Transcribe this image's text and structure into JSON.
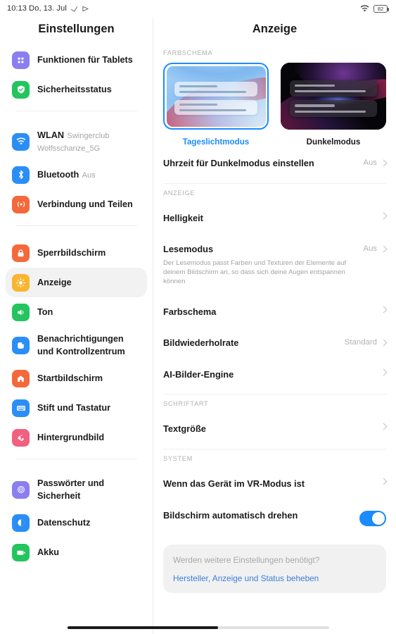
{
  "statusbar": {
    "time_date": "10:13 Do, 13. Jul",
    "left_icons": [
      "silent-mode-icon",
      "location-icon"
    ],
    "wifi_icon": "wifi-icon",
    "battery_level": "82"
  },
  "sidebar": {
    "title": "Einstellungen",
    "groups": [
      {
        "items": [
          {
            "label": "Funktionen für Tablets",
            "sub": "",
            "icon": "tablet-features-icon",
            "color": "#8b7ef0"
          },
          {
            "label": "Sicherheitsstatus",
            "sub": "",
            "icon": "security-shield-icon",
            "color": "#23c55e"
          }
        ]
      },
      {
        "items": [
          {
            "label": "WLAN",
            "sub": "Swingerclub Wolfsschanze_5G",
            "icon": "wifi-icon",
            "color": "#2b8ef5"
          },
          {
            "label": "Bluetooth",
            "sub": "Aus",
            "icon": "bluetooth-icon",
            "color": "#2b8ef5"
          },
          {
            "label": "Verbindung und Teilen",
            "sub": "",
            "icon": "share-connect-icon",
            "color": "#f4693b"
          }
        ]
      },
      {
        "items": [
          {
            "label": "Sperrbildschirm",
            "sub": "",
            "icon": "lock-icon",
            "color": "#f4693b"
          },
          {
            "label": "Anzeige",
            "sub": "",
            "icon": "brightness-sun-icon",
            "color": "#f9b battery",
            "selected": true
          },
          {
            "label": "Ton",
            "sub": "",
            "icon": "speaker-icon",
            "color": "#23c55e"
          },
          {
            "label": "Benachrichtigungen und Kontrollzentrum",
            "sub": "",
            "icon": "notifications-icon",
            "color": "#2b8ef5"
          },
          {
            "label": "Startbildschirm",
            "sub": "",
            "icon": "home-icon",
            "color": "#f4693b"
          },
          {
            "label": "Stift und Tastatur",
            "sub": "",
            "icon": "keyboard-icon",
            "color": "#2b8ef5"
          },
          {
            "label": "Hintergrundbild",
            "sub": "",
            "icon": "wallpaper-flower-icon",
            "color": "#f2607f"
          }
        ]
      },
      {
        "items": [
          {
            "label": "Passwörter und Sicherheit",
            "sub": "",
            "icon": "fingerprint-icon",
            "color": "#8b7ef0"
          },
          {
            "label": "Datenschutz",
            "sub": "",
            "icon": "privacy-icon",
            "color": "#2b8ef5"
          },
          {
            "label": "Akku",
            "sub": "",
            "icon": "battery-icon",
            "color": "#23c55e"
          }
        ]
      }
    ]
  },
  "main": {
    "title": "Anzeige",
    "sections": {
      "colorscheme_caption": "FARBSCHEMA",
      "display_caption": "ANZEIGE",
      "font_caption": "SCHRIFTART",
      "system_caption": "SYSTEM"
    },
    "themes": [
      {
        "label": "Tageslichtmodus",
        "selected": true
      },
      {
        "label": "Dunkelmodus",
        "selected": false
      }
    ],
    "rows": {
      "dark_schedule": {
        "title": "Uhrzeit für Dunkelmodus einstellen",
        "value": "Aus"
      },
      "brightness": {
        "title": "Helligkeit",
        "value": ""
      },
      "reading_mode": {
        "title": "Lesemodus",
        "desc": "Der Lesemodus passt Farben und Texturen der Elemente auf deinem Bildschirm an, so dass sich deine Augen entspannen können",
        "value": "Aus"
      },
      "color_scheme": {
        "title": "Farbschema",
        "value": ""
      },
      "refresh_rate": {
        "title": "Bildwiederholrate",
        "value": "Standard"
      },
      "ai_image_engine": {
        "title": "AI-Bilder-Engine",
        "value": ""
      },
      "text_size": {
        "title": "Textgröße",
        "value": ""
      },
      "vr_mode": {
        "title": "Wenn das Gerät im VR-Modus ist",
        "value": ""
      },
      "auto_rotate": {
        "title": "Bildschirm automatisch drehen",
        "toggle_on": true
      }
    },
    "suggestion": {
      "question": "Werden weitere Einstellungen benötigt?",
      "link": "Hersteller, Anzeige und Status beheben"
    }
  },
  "colors": {
    "accent": "#1a8cff",
    "selected_bg": "#f2f2f3",
    "link": "#3c7fd4"
  }
}
